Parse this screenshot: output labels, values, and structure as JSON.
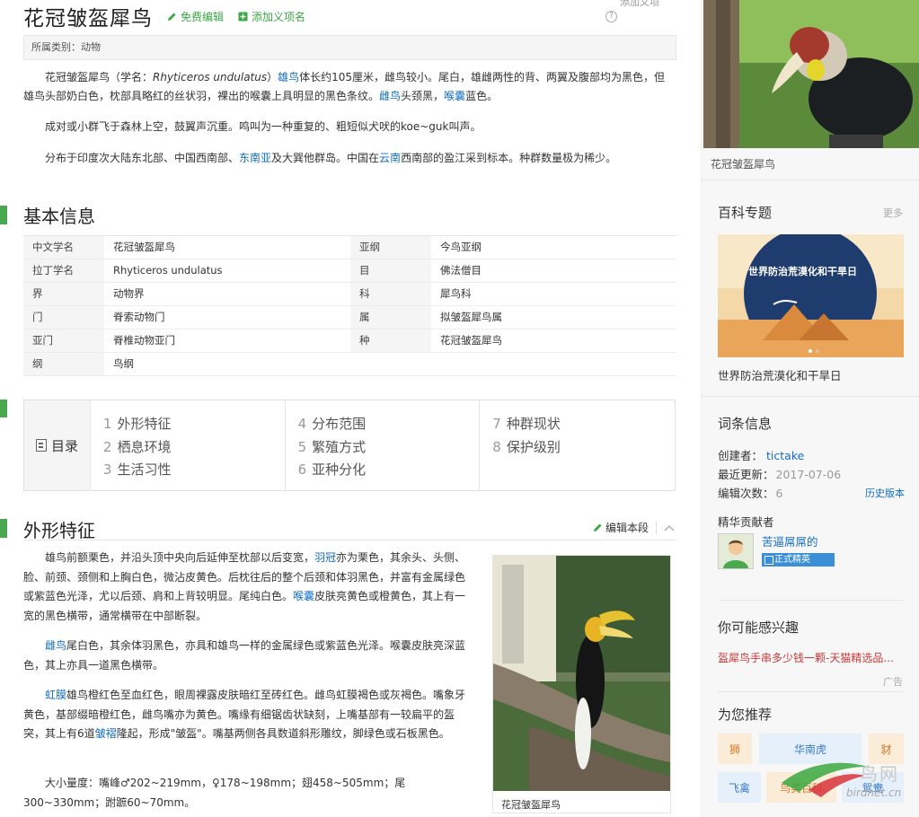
{
  "header": {
    "title": "花冠皱盔犀鸟",
    "edit_label": "免费编辑",
    "add_label": "添加义项名",
    "top_right_label": "添加义项"
  },
  "category": "所属类别：动物",
  "intro": {
    "p1_before": "花冠皱盔犀鸟（学名：",
    "p1_latin": "Rhyticeros undulatus",
    "p1_close": "）",
    "p1_link1": "雄鸟",
    "p1_mid": "体长约105厘米，雌鸟较小。尾白，雄雌两性的背、两翼及腹部均为黑色，但雄鸟头部奶白色，枕部具略红的丝状羽，裸出的喉囊上具明显的黑色条纹。",
    "p1_link2": "雌鸟",
    "p1_mid2": "头颈黑，",
    "p1_link3": "喉囊",
    "p1_end": "蓝色。",
    "p2": "成对或小群飞于森林上空，鼓翼声沉重。鸣叫为一种重复的、粗短似犬吠的koe~guk叫声。",
    "p3_before": "分布于印度次大陆东北部、中国西南部、",
    "p3_link1": "东南亚",
    "p3_mid": "及大巽他群岛。中国在",
    "p3_link2": "云南",
    "p3_end": "西南部的盈江采到标本。种群数量极为稀少。"
  },
  "basic_info": {
    "title": "基本信息",
    "rows": [
      {
        "k1": "中文学名",
        "v1": "花冠皱盔犀鸟",
        "k2": "亚纲",
        "v2": "今鸟亚纲"
      },
      {
        "k1": "拉丁学名",
        "v1": "Rhyticeros undulatus",
        "k2": "目",
        "v2": "佛法僧目"
      },
      {
        "k1": "界",
        "v1": "动物界",
        "k2": "科",
        "v2": "犀鸟科"
      },
      {
        "k1": "门",
        "v1": "脊索动物门",
        "k2": "属",
        "v2": "拟皱盔犀鸟属"
      },
      {
        "k1": "亚门",
        "v1": "脊椎动物亚门",
        "k2": "种",
        "v2": "花冠皱盔犀鸟"
      },
      {
        "k1": "纲",
        "v1": "鸟纲",
        "k2": "",
        "v2": ""
      }
    ]
  },
  "catalog": {
    "label": "目录",
    "items": [
      {
        "n": "1",
        "t": "外形特征"
      },
      {
        "n": "2",
        "t": "栖息环境"
      },
      {
        "n": "3",
        "t": "生活习性"
      },
      {
        "n": "4",
        "t": "分布范围"
      },
      {
        "n": "5",
        "t": "繁殖方式"
      },
      {
        "n": "6",
        "t": "亚种分化"
      },
      {
        "n": "7",
        "t": "种群现状"
      },
      {
        "n": "8",
        "t": "保护级别"
      }
    ]
  },
  "shape_section": {
    "title": "外形特征",
    "edit_label": "编辑本段",
    "p1_before": "雄鸟前额栗色，并沿头顶中央向后延伸至枕部以后变宽，",
    "p1_link1": "羽冠",
    "p1_mid": "亦为栗色，其余头、头侧、脸、前颈、颈侧和上胸白色，微沾皮黄色。后枕往后的整个后颈和体羽黑色，并富有金属绿色或紫蓝色光泽，尤以后颈、肩和上背较明显。尾纯白色。",
    "p1_link2": "喉囊",
    "p1_end": "皮肤亮黄色或橙黄色，其上有一宽的黑色横带，通常横带在中部断裂。",
    "p2_link": "雌鸟",
    "p2_end": "尾白色，其余体羽黑色，亦具和雄鸟一样的金属绿色或紫蓝色光泽。喉囊皮肤亮深蓝色，其上亦具一道黑色横带。",
    "p3_link1": "虹膜",
    "p3_mid": "雄鸟橙红色至血红色，眼周裸露皮肤暗红至砖红色。雌鸟虹膜褐色或灰褐色。嘴象牙黄色，基部缀暗橙红色，雌鸟嘴亦为黄色。嘴缘有细锯齿状缺刻，上嘴基部有一较扁平的盔突，其上有6道",
    "p3_link2": "皱褶",
    "p3_end": "隆起，形成\"皱盔\"。嘴基两侧各具数道斜形雕纹，脚绿色或石板黑色。",
    "p4": "大小量度：嘴峰♂202~219mm，♀178~198mm；翅458~505mm；尾300~330mm；跗蹠60~70mm。",
    "figure_caption": "花冠皱盔犀鸟"
  },
  "sidebar": {
    "figure_caption": "花冠皱盔犀鸟",
    "topic_title": "百科专题",
    "topic_more": "更多",
    "topic_banner_text": "世界防治荒漠化和干旱日",
    "topic_caption": "世界防治荒漠化和干旱日",
    "entry_title": "词条信息",
    "creator_label": "创建者：",
    "creator": "tictake",
    "updated_label": "最近更新：",
    "updated": "2017-07-06",
    "edits_label": "编辑次数：",
    "edits": "6",
    "history_label": "历史版本",
    "contrib_title": "精华贡献者",
    "contrib_name": "苦逼屌屌的",
    "contrib_badge": "正式精英",
    "interest_title": "你可能感兴趣",
    "ad_text": "盔犀鸟手串多少钱一颗-天猫精选品...",
    "ad_tag": "广告",
    "recommend_title": "为您推荐",
    "chips": [
      "狮",
      "华南虎",
      "豺",
      "飞禽",
      "鸟类百科",
      "鸳鸯"
    ],
    "watermark_cn": "鸟网",
    "watermark_en": "birdnet.cn"
  },
  "colors": {
    "accent_green": "#4aa84f",
    "link_blue": "#136ec2",
    "ad_red": "#c83a3a"
  }
}
